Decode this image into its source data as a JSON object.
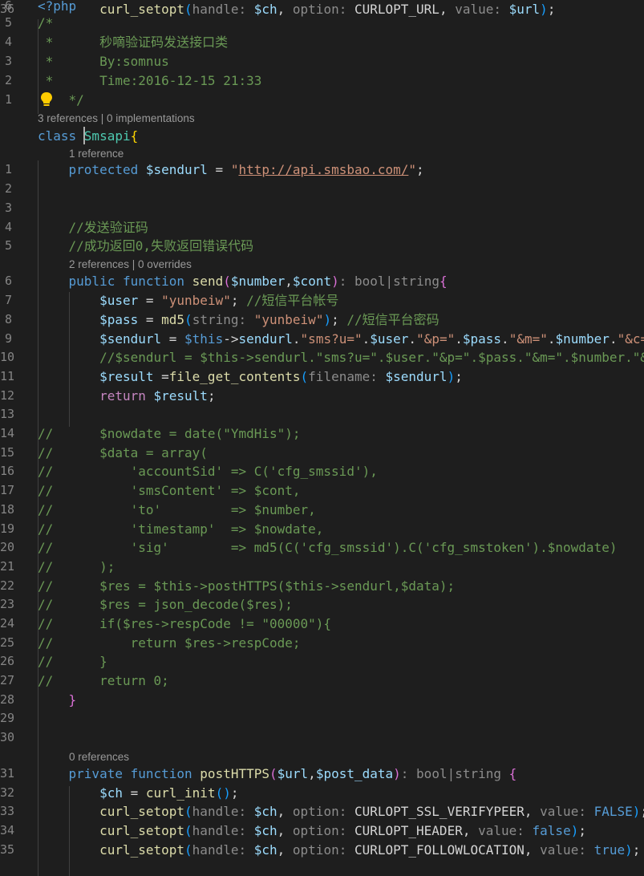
{
  "code_lens": [
    {
      "text": "3 references | 0 implementations"
    },
    {
      "text": "1 reference"
    },
    {
      "text": "2 references | 0 overrides"
    },
    {
      "text": "0 references"
    }
  ],
  "lines": [
    {
      "num": "6",
      "tokens": [
        {
          "t": "<?php",
          "c": "kw"
        }
      ]
    },
    {
      "num": "5",
      "tokens": [
        {
          "t": "/*",
          "c": "com"
        }
      ]
    },
    {
      "num": "4",
      "tokens": [
        {
          "t": " *      秒嘀验证码发送接口类",
          "c": "com"
        }
      ]
    },
    {
      "num": "3",
      "tokens": [
        {
          "t": " *      By:somnus",
          "c": "com"
        }
      ]
    },
    {
      "num": "2",
      "tokens": [
        {
          "t": " *      Time:2016-12-15 21:33",
          "c": "com"
        }
      ]
    },
    {
      "num": "1",
      "tokens": [
        {
          "t": "    */",
          "c": "com"
        }
      ]
    },
    {
      "num": "",
      "tokens": [
        {
          "t": "class ",
          "c": "kw"
        },
        {
          "t": "Smsapi",
          "c": "cls"
        },
        {
          "t": "{",
          "c": "br1"
        }
      ]
    },
    {
      "num": "1",
      "tokens": [
        {
          "t": "    "
        },
        {
          "t": "protected ",
          "c": "kw"
        },
        {
          "t": "$sendurl",
          "c": "var"
        },
        {
          "t": " = ",
          "c": "plain"
        },
        {
          "t": "\"",
          "c": "str"
        },
        {
          "t": "http://api.smsbao.com/",
          "c": "str link"
        },
        {
          "t": "\"",
          "c": "str"
        },
        {
          "t": ";",
          "c": "plain"
        }
      ]
    },
    {
      "num": "2",
      "tokens": []
    },
    {
      "num": "3",
      "tokens": []
    },
    {
      "num": "4",
      "tokens": [
        {
          "t": "    "
        },
        {
          "t": "//发送验证码",
          "c": "com"
        }
      ]
    },
    {
      "num": "5",
      "tokens": [
        {
          "t": "    "
        },
        {
          "t": "//成功返回0,失败返回错误代码",
          "c": "com"
        }
      ]
    },
    {
      "num": "6",
      "tokens": [
        {
          "t": "    "
        },
        {
          "t": "public ",
          "c": "kw"
        },
        {
          "t": "function ",
          "c": "kw"
        },
        {
          "t": "send",
          "c": "fn"
        },
        {
          "t": "(",
          "c": "br2"
        },
        {
          "t": "$number",
          "c": "var"
        },
        {
          "t": ",",
          "c": "plain"
        },
        {
          "t": "$cont",
          "c": "var"
        },
        {
          "t": ")",
          "c": "br2"
        },
        {
          "t": ": bool|string",
          "c": "hint"
        },
        {
          "t": "{",
          "c": "br2"
        }
      ]
    },
    {
      "num": "7",
      "tokens": [
        {
          "t": "        "
        },
        {
          "t": "$user",
          "c": "var"
        },
        {
          "t": " = ",
          "c": "plain"
        },
        {
          "t": "\"yunbeiw\"",
          "c": "str"
        },
        {
          "t": "; ",
          "c": "plain"
        },
        {
          "t": "//短信平台帐号",
          "c": "com"
        }
      ]
    },
    {
      "num": "8",
      "tokens": [
        {
          "t": "        "
        },
        {
          "t": "$pass",
          "c": "var"
        },
        {
          "t": " = ",
          "c": "plain"
        },
        {
          "t": "md5",
          "c": "fn"
        },
        {
          "t": "(",
          "c": "br3"
        },
        {
          "t": "string: ",
          "c": "hint"
        },
        {
          "t": "\"yunbeiw\"",
          "c": "str"
        },
        {
          "t": ")",
          "c": "br3"
        },
        {
          "t": "; ",
          "c": "plain"
        },
        {
          "t": "//短信平台密码",
          "c": "com"
        }
      ]
    },
    {
      "num": "9",
      "tokens": [
        {
          "t": "        "
        },
        {
          "t": "$sendurl",
          "c": "var"
        },
        {
          "t": " = ",
          "c": "plain"
        },
        {
          "t": "$this",
          "c": "kw"
        },
        {
          "t": "->",
          "c": "plain"
        },
        {
          "t": "sendurl",
          "c": "var"
        },
        {
          "t": ".",
          "c": "plain"
        },
        {
          "t": "\"sms?u=\"",
          "c": "str"
        },
        {
          "t": ".",
          "c": "plain"
        },
        {
          "t": "$user",
          "c": "var"
        },
        {
          "t": ".",
          "c": "plain"
        },
        {
          "t": "\"&p=\"",
          "c": "str"
        },
        {
          "t": ".",
          "c": "plain"
        },
        {
          "t": "$pass",
          "c": "var"
        },
        {
          "t": ".",
          "c": "plain"
        },
        {
          "t": "\"&m=\"",
          "c": "str"
        },
        {
          "t": ".",
          "c": "plain"
        },
        {
          "t": "$number",
          "c": "var"
        },
        {
          "t": ".",
          "c": "plain"
        },
        {
          "t": "\"&c=",
          "c": "str"
        }
      ]
    },
    {
      "num": "10",
      "tokens": [
        {
          "t": "        "
        },
        {
          "t": "//$sendurl = $this->sendurl.\"sms?u=\".$user.\"&p=\".$pass.\"&m=\".$number.\"&",
          "c": "com"
        }
      ]
    },
    {
      "num": "11",
      "tokens": [
        {
          "t": "        "
        },
        {
          "t": "$result",
          "c": "var"
        },
        {
          "t": " =",
          "c": "plain"
        },
        {
          "t": "file_get_contents",
          "c": "fn"
        },
        {
          "t": "(",
          "c": "br3"
        },
        {
          "t": "filename: ",
          "c": "hint"
        },
        {
          "t": "$sendurl",
          "c": "var"
        },
        {
          "t": ")",
          "c": "br3"
        },
        {
          "t": ";",
          "c": "plain"
        }
      ]
    },
    {
      "num": "12",
      "tokens": [
        {
          "t": "        "
        },
        {
          "t": "return ",
          "c": "ctl"
        },
        {
          "t": "$result",
          "c": "var"
        },
        {
          "t": ";",
          "c": "plain"
        }
      ]
    },
    {
      "num": "13",
      "tokens": []
    },
    {
      "num": "14",
      "tokens": [
        {
          "t": "//      $nowdate = date(\"YmdHis\");",
          "c": "com"
        }
      ]
    },
    {
      "num": "15",
      "tokens": [
        {
          "t": "//      $data = array(",
          "c": "com"
        }
      ]
    },
    {
      "num": "16",
      "tokens": [
        {
          "t": "//          'accountSid' => C('cfg_smssid'),",
          "c": "com"
        }
      ]
    },
    {
      "num": "17",
      "tokens": [
        {
          "t": "//          'smsContent' => $cont,",
          "c": "com"
        }
      ]
    },
    {
      "num": "18",
      "tokens": [
        {
          "t": "//          'to'         => $number,",
          "c": "com"
        }
      ]
    },
    {
      "num": "19",
      "tokens": [
        {
          "t": "//          'timestamp'  => $nowdate,",
          "c": "com"
        }
      ]
    },
    {
      "num": "20",
      "tokens": [
        {
          "t": "//          'sig'        => md5(C('cfg_smssid').C('cfg_smstoken').$nowdate)",
          "c": "com"
        }
      ]
    },
    {
      "num": "21",
      "tokens": [
        {
          "t": "//      );",
          "c": "com"
        }
      ]
    },
    {
      "num": "22",
      "tokens": [
        {
          "t": "//      $res = $this->postHTTPS($this->sendurl,$data);",
          "c": "com"
        }
      ]
    },
    {
      "num": "23",
      "tokens": [
        {
          "t": "//      $res = json_decode($res);",
          "c": "com"
        }
      ]
    },
    {
      "num": "24",
      "tokens": [
        {
          "t": "//      if($res->respCode != \"00000\"){",
          "c": "com"
        }
      ]
    },
    {
      "num": "25",
      "tokens": [
        {
          "t": "//          return $res->respCode;",
          "c": "com"
        }
      ]
    },
    {
      "num": "26",
      "tokens": [
        {
          "t": "//      }",
          "c": "com"
        }
      ]
    },
    {
      "num": "27",
      "tokens": [
        {
          "t": "//      return 0;",
          "c": "com"
        }
      ]
    },
    {
      "num": "28",
      "tokens": [
        {
          "t": "    "
        },
        {
          "t": "}",
          "c": "br2"
        }
      ]
    },
    {
      "num": "29",
      "tokens": []
    },
    {
      "num": "30",
      "tokens": []
    },
    {
      "num": "31",
      "tokens": [
        {
          "t": "    "
        },
        {
          "t": "private ",
          "c": "kw"
        },
        {
          "t": "function ",
          "c": "kw"
        },
        {
          "t": "postHTTPS",
          "c": "fn"
        },
        {
          "t": "(",
          "c": "br2"
        },
        {
          "t": "$url",
          "c": "var"
        },
        {
          "t": ",",
          "c": "plain"
        },
        {
          "t": "$post_data",
          "c": "var"
        },
        {
          "t": ")",
          "c": "br2"
        },
        {
          "t": ": bool|string ",
          "c": "hint"
        },
        {
          "t": "{",
          "c": "br2"
        }
      ]
    },
    {
      "num": "32",
      "tokens": [
        {
          "t": "        "
        },
        {
          "t": "$ch",
          "c": "var"
        },
        {
          "t": " = ",
          "c": "plain"
        },
        {
          "t": "curl_init",
          "c": "fn"
        },
        {
          "t": "()",
          "c": "br3"
        },
        {
          "t": ";",
          "c": "plain"
        }
      ]
    },
    {
      "num": "33",
      "tokens": [
        {
          "t": "        "
        },
        {
          "t": "curl_setopt",
          "c": "fn"
        },
        {
          "t": "(",
          "c": "br3"
        },
        {
          "t": "handle: ",
          "c": "hint"
        },
        {
          "t": "$ch",
          "c": "var"
        },
        {
          "t": ", ",
          "c": "plain"
        },
        {
          "t": "option: ",
          "c": "hint"
        },
        {
          "t": "CURLOPT_SSL_VERIFYPEER",
          "c": "plain"
        },
        {
          "t": ", ",
          "c": "plain"
        },
        {
          "t": "value: ",
          "c": "hint"
        },
        {
          "t": "FALSE",
          "c": "kw"
        },
        {
          "t": ")",
          "c": "br3"
        },
        {
          "t": ";",
          "c": "plain"
        }
      ]
    },
    {
      "num": "34",
      "tokens": [
        {
          "t": "        "
        },
        {
          "t": "curl_setopt",
          "c": "fn"
        },
        {
          "t": "(",
          "c": "br3"
        },
        {
          "t": "handle: ",
          "c": "hint"
        },
        {
          "t": "$ch",
          "c": "var"
        },
        {
          "t": ", ",
          "c": "plain"
        },
        {
          "t": "option: ",
          "c": "hint"
        },
        {
          "t": "CURLOPT_HEADER",
          "c": "plain"
        },
        {
          "t": ", ",
          "c": "plain"
        },
        {
          "t": "value: ",
          "c": "hint"
        },
        {
          "t": "false",
          "c": "kw"
        },
        {
          "t": ")",
          "c": "br3"
        },
        {
          "t": ";",
          "c": "plain"
        }
      ]
    },
    {
      "num": "35",
      "tokens": [
        {
          "t": "        "
        },
        {
          "t": "curl_setopt",
          "c": "fn"
        },
        {
          "t": "(",
          "c": "br3"
        },
        {
          "t": "handle: ",
          "c": "hint"
        },
        {
          "t": "$ch",
          "c": "var"
        },
        {
          "t": ", ",
          "c": "plain"
        },
        {
          "t": "option: ",
          "c": "hint"
        },
        {
          "t": "CURLOPT_FOLLOWLOCATION",
          "c": "plain"
        },
        {
          "t": ", ",
          "c": "plain"
        },
        {
          "t": "value: ",
          "c": "hint"
        },
        {
          "t": "true",
          "c": "kw"
        },
        {
          "t": ")",
          "c": "br3"
        },
        {
          "t": ";",
          "c": "plain"
        }
      ]
    },
    {
      "num": "36",
      "tokens": [
        {
          "t": "        "
        },
        {
          "t": "curl_setopt",
          "c": "fn"
        },
        {
          "t": "(",
          "c": "br3"
        },
        {
          "t": "handle: ",
          "c": "hint"
        },
        {
          "t": "$ch",
          "c": "var"
        },
        {
          "t": ", ",
          "c": "plain"
        },
        {
          "t": "option: ",
          "c": "hint"
        },
        {
          "t": "CURLOPT_URL",
          "c": "plain"
        },
        {
          "t": ", ",
          "c": "plain"
        },
        {
          "t": "value: ",
          "c": "hint"
        },
        {
          "t": "$url",
          "c": "var"
        },
        {
          "t": ")",
          "c": "br3"
        },
        {
          "t": ";",
          "c": "plain"
        }
      ]
    }
  ]
}
